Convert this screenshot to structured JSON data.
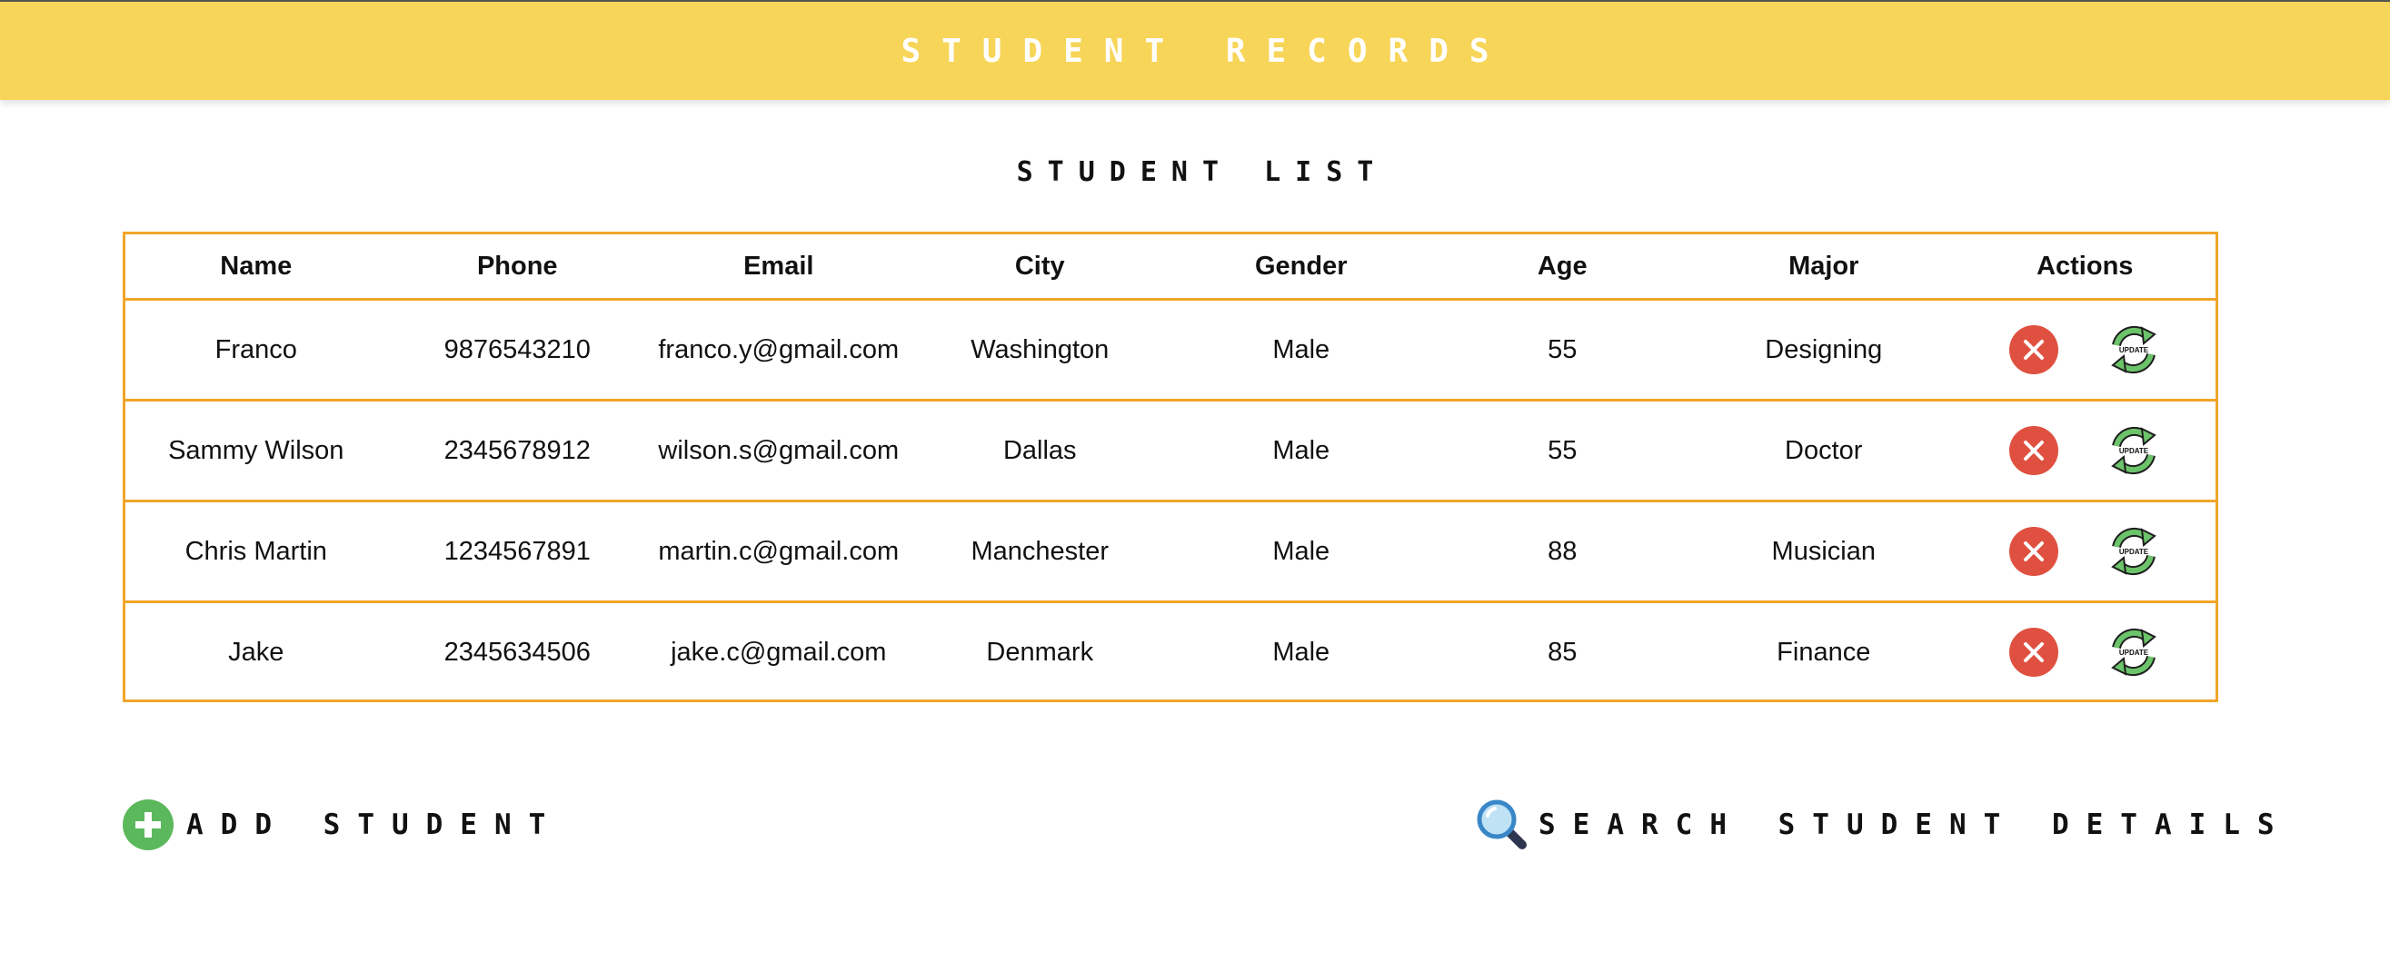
{
  "header": {
    "title": "STUDENT RECORDS"
  },
  "list_title": "STUDENT LIST",
  "table": {
    "columns": [
      "Name",
      "Phone",
      "Email",
      "City",
      "Gender",
      "Age",
      "Major",
      "Actions"
    ],
    "rows": [
      [
        "Franco",
        "9876543210",
        "franco.y@gmail.com",
        "Washington",
        "Male",
        "55",
        "Designing"
      ],
      [
        "Sammy Wilson",
        "2345678912",
        "wilson.s@gmail.com",
        "Dallas",
        "Male",
        "55",
        "Doctor"
      ],
      [
        "Chris Martin",
        "1234567891",
        "martin.c@gmail.com",
        "Manchester",
        "Male",
        "88",
        "Musician"
      ],
      [
        "Jake",
        "2345634506",
        "jake.c@gmail.com",
        "Denmark",
        "Male",
        "85",
        "Finance"
      ]
    ],
    "update_icon_text": "UPDATE"
  },
  "add_student": {
    "label": "ADD STUDENT",
    "icon": "plus-circle-icon"
  },
  "search_student": {
    "label": "SEARCH STUDENT DETAILS",
    "icon": "magnifier-icon"
  },
  "colors": {
    "header_bg": "#f7d558",
    "table_border": "#f0a528",
    "delete": "#e05040",
    "update": "#5cb85c",
    "add": "#5cb85c"
  }
}
